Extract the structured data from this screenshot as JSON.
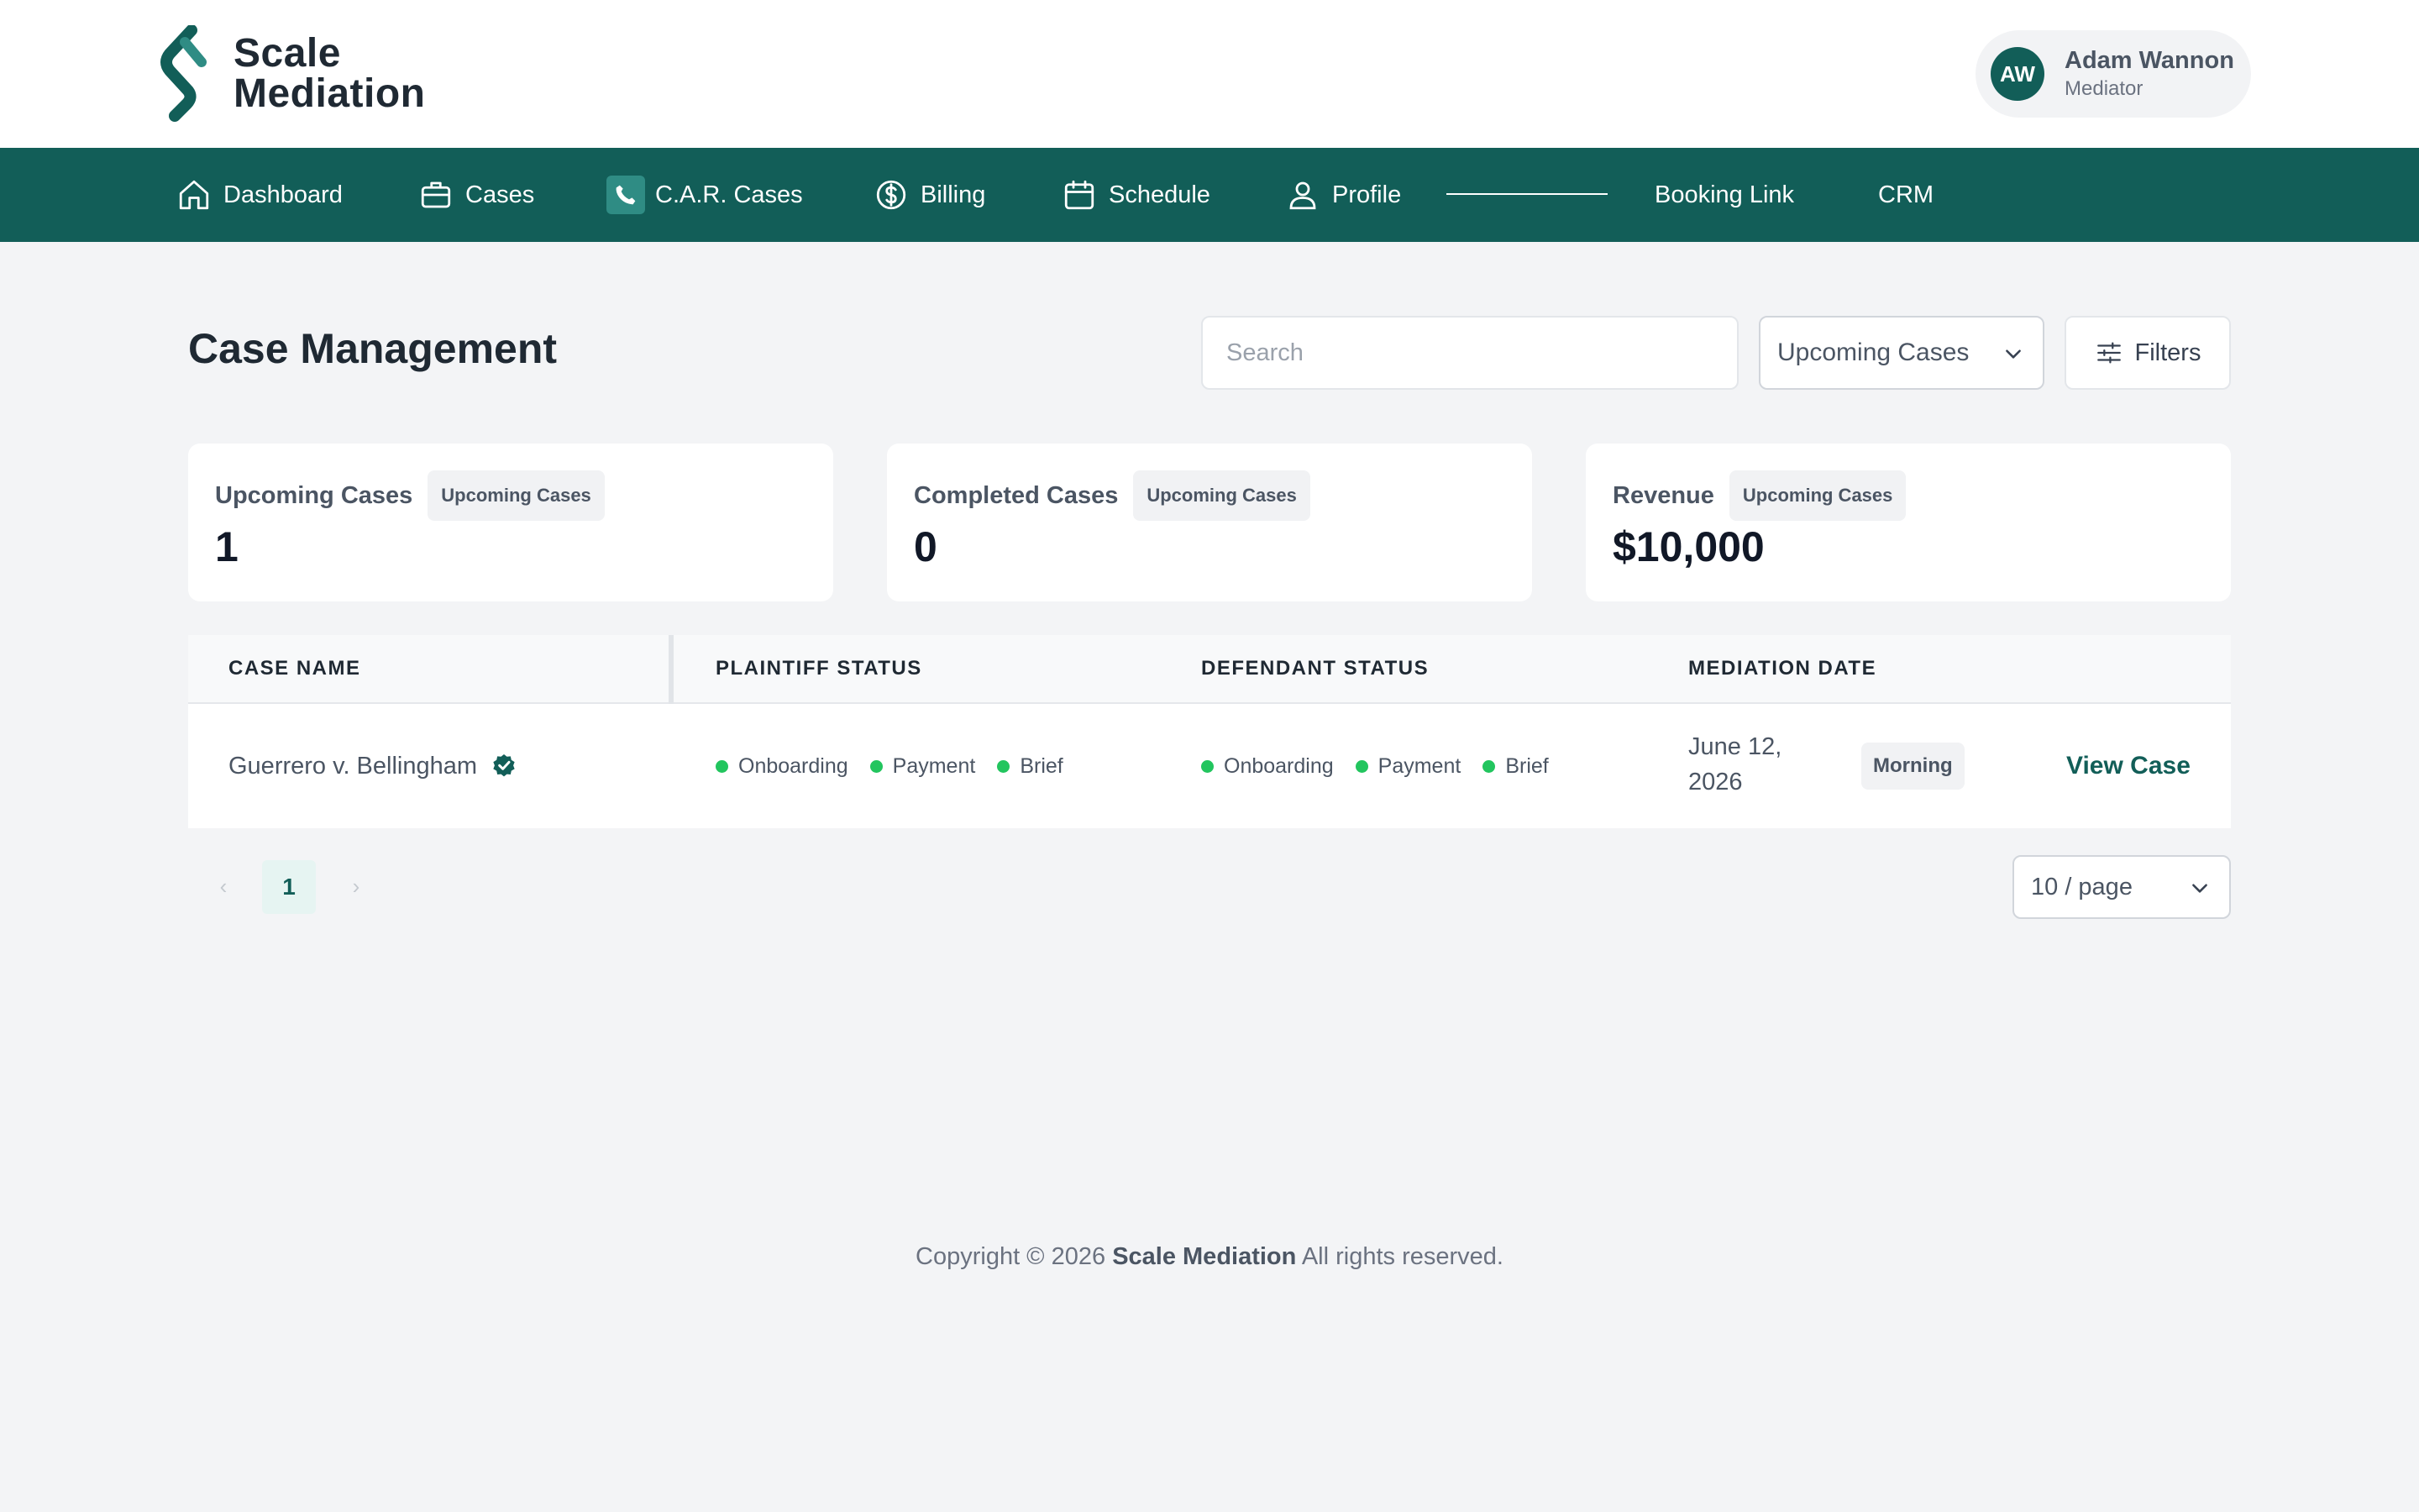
{
  "brand": {
    "line1": "Scale",
    "line2": "Mediation",
    "logo_icon": "scale-mediation-logo-icon",
    "brand_color": "#125e58"
  },
  "user": {
    "initials": "AW",
    "name": "Adam Wannon",
    "role": "Mediator"
  },
  "nav": {
    "items": [
      {
        "label": "Dashboard",
        "icon": "home-icon"
      },
      {
        "label": "Cases",
        "icon": "briefcase-icon"
      },
      {
        "label": "C.A.R. Cases",
        "icon": "phone-icon"
      },
      {
        "label": "Billing",
        "icon": "dollar-circle-icon"
      },
      {
        "label": "Schedule",
        "icon": "calendar-icon"
      },
      {
        "label": "Profile",
        "icon": "user-icon"
      },
      {
        "label": "Booking Link"
      },
      {
        "label": "CRM"
      }
    ]
  },
  "page": {
    "title": "Case Management",
    "search_placeholder": "Search",
    "search_value": "",
    "view_select": "Upcoming Cases",
    "filters_label": "Filters"
  },
  "stats": [
    {
      "label": "Upcoming Cases",
      "badge": "Upcoming Cases",
      "value": "1"
    },
    {
      "label": "Completed Cases",
      "badge": "Upcoming Cases",
      "value": "0"
    },
    {
      "label": "Revenue",
      "badge": "Upcoming Cases",
      "value": "$10,000"
    }
  ],
  "table": {
    "columns": [
      "CASE NAME",
      "PLAINTIFF STATUS",
      "DEFENDANT STATUS",
      "MEDIATION DATE"
    ],
    "rows": [
      {
        "case_name": "Guerrero v. Bellingham",
        "plaintiff_status": [
          "Onboarding",
          "Payment",
          "Brief"
        ],
        "defendant_status": [
          "Onboarding",
          "Payment",
          "Brief"
        ],
        "mediation_date": "June 12, 2026",
        "time_slot": "Morning",
        "action": "View Case"
      }
    ]
  },
  "pagination": {
    "prev": "‹",
    "current_page": "1",
    "next": "›",
    "page_size": "10 / page"
  },
  "footer": {
    "prefix": "Copyright © 2026",
    "company": "Scale Mediation",
    "suffix": "All rights reserved."
  },
  "colors": {
    "primary": "#125e58",
    "status_green": "#22c55e",
    "background": "#f3f4f6"
  }
}
